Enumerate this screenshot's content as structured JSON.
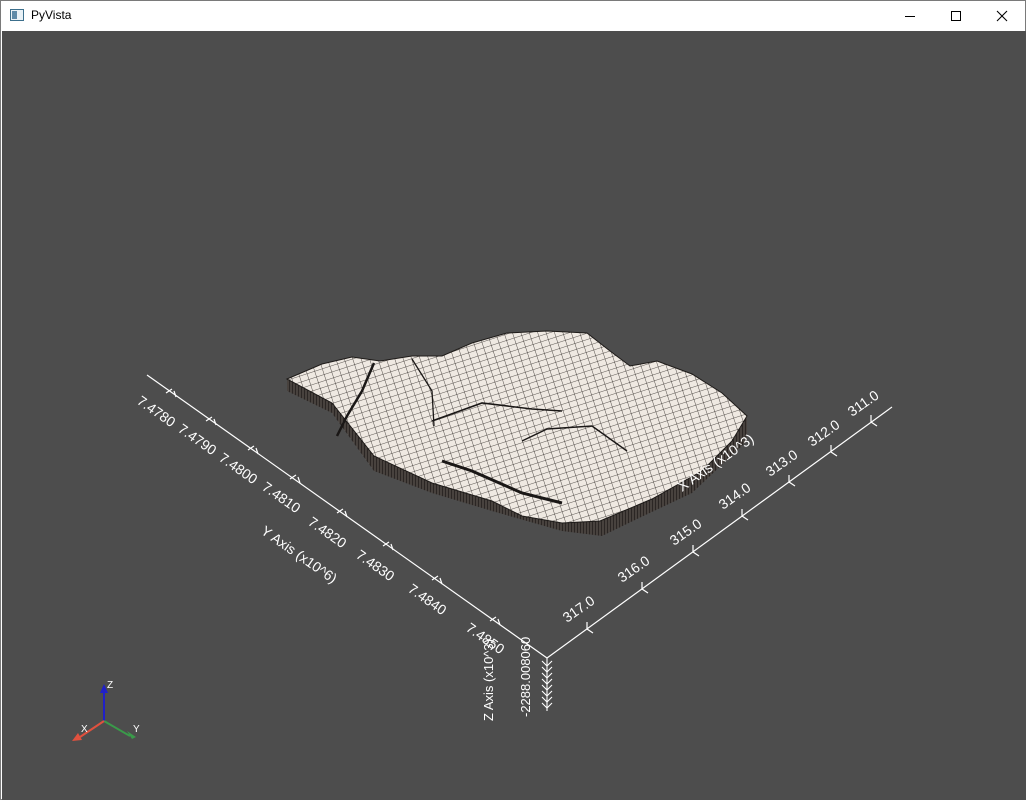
{
  "window": {
    "title": "PyVista"
  },
  "axes": {
    "x_title": "X Axis (x10^3)",
    "y_title": "Y Axis (x10^6)",
    "z_title": "Z Axis (x10^3)",
    "x_ticks": [
      "317.0",
      "316.0",
      "315.0",
      "314.0",
      "313.0",
      "312.0",
      "311.0"
    ],
    "y_ticks": [
      "7.4780",
      "7.4790",
      "7.4800",
      "7.4810",
      "7.4820",
      "7.4830",
      "7.4840",
      "7.4850"
    ],
    "z_ticks_overlap": "-2288.008060"
  },
  "orientation_widget": {
    "x_label": "X",
    "y_label": "Y",
    "z_label": "Z",
    "x_color": "#e0513e",
    "y_color": "#3a9a4a",
    "z_color": "#2020c8"
  },
  "colors": {
    "background": "#4d4d4d",
    "surface": "#efe9e2",
    "grid_line": "#2a2623"
  }
}
